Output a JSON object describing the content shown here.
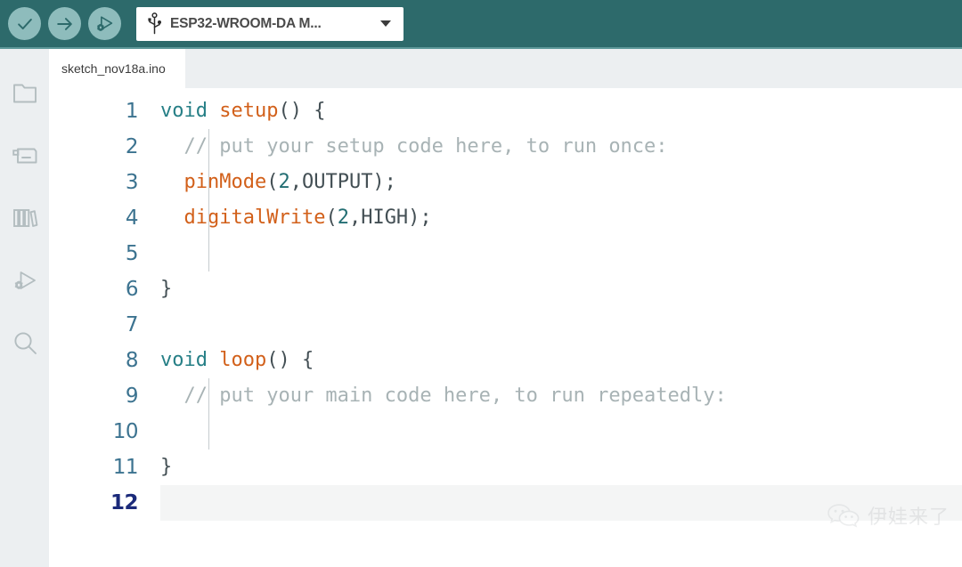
{
  "toolbar": {
    "buttons": [
      {
        "name": "verify-button",
        "icon": "checkmark-icon",
        "tooltip": "Verify"
      },
      {
        "name": "upload-button",
        "icon": "arrow-right-icon",
        "tooltip": "Upload"
      },
      {
        "name": "debug-button",
        "icon": "debug-play-bug-icon",
        "tooltip": "Start Debugging"
      }
    ],
    "board_selector": {
      "icon": "usb-icon",
      "value": "ESP32-WROOM-DA M...",
      "caret_icon": "chevron-down-icon"
    },
    "background_color": "#2d6a6b",
    "button_color": "#8ebcbc"
  },
  "activitybar": {
    "items": [
      {
        "name": "sidebar-item-sketchbook",
        "icon": "folder-icon"
      },
      {
        "name": "sidebar-item-boards-manager",
        "icon": "boards-manager-icon"
      },
      {
        "name": "sidebar-item-library-manager",
        "icon": "library-books-icon"
      },
      {
        "name": "sidebar-item-debug",
        "icon": "debug-play-bug-icon"
      },
      {
        "name": "sidebar-item-search",
        "icon": "search-icon"
      }
    ],
    "background_color": "#eceff1"
  },
  "tabs": [
    {
      "label": "sketch_nov18a.ino",
      "active": true
    }
  ],
  "editor": {
    "active_line": 12,
    "total_lines": 12,
    "colors": {
      "keyword": "#267f86",
      "function": "#d2601a",
      "comment": "#a8b3b5",
      "number": "#236e73",
      "plain": "#434f54",
      "line_number": "#3c7390",
      "active_line_number": "#1b2a7a",
      "active_line_bg": "#f4f5f5"
    },
    "lines": [
      {
        "num": "1",
        "tokens": [
          {
            "t": "void",
            "c": "kw"
          },
          {
            "t": " ",
            "c": "pl"
          },
          {
            "t": "setup",
            "c": "fn"
          },
          {
            "t": "() {",
            "c": "pl"
          }
        ]
      },
      {
        "num": "2",
        "tokens": [
          {
            "t": "  // put your setup code here, to run once:",
            "c": "com"
          }
        ]
      },
      {
        "num": "3",
        "tokens": [
          {
            "t": "  ",
            "c": "pl"
          },
          {
            "t": "pinMode",
            "c": "fn"
          },
          {
            "t": "(",
            "c": "pl"
          },
          {
            "t": "2",
            "c": "num"
          },
          {
            "t": ",OUTPUT);",
            "c": "pl"
          }
        ]
      },
      {
        "num": "4",
        "tokens": [
          {
            "t": "  ",
            "c": "pl"
          },
          {
            "t": "digitalWrite",
            "c": "fn"
          },
          {
            "t": "(",
            "c": "pl"
          },
          {
            "t": "2",
            "c": "num"
          },
          {
            "t": ",HIGH);",
            "c": "pl"
          }
        ]
      },
      {
        "num": "5",
        "tokens": [
          {
            "t": "",
            "c": "pl"
          }
        ]
      },
      {
        "num": "6",
        "tokens": [
          {
            "t": "}",
            "c": "pl"
          }
        ]
      },
      {
        "num": "7",
        "tokens": [
          {
            "t": "",
            "c": "pl"
          }
        ]
      },
      {
        "num": "8",
        "tokens": [
          {
            "t": "void",
            "c": "kw"
          },
          {
            "t": " ",
            "c": "pl"
          },
          {
            "t": "loop",
            "c": "fn"
          },
          {
            "t": "() {",
            "c": "pl"
          }
        ]
      },
      {
        "num": "9",
        "tokens": [
          {
            "t": "  // put your main code here, to run repeatedly:",
            "c": "com"
          }
        ]
      },
      {
        "num": "10",
        "tokens": [
          {
            "t": "",
            "c": "pl"
          }
        ]
      },
      {
        "num": "11",
        "tokens": [
          {
            "t": "}",
            "c": "pl"
          }
        ]
      },
      {
        "num": "12",
        "tokens": [
          {
            "t": "",
            "c": "pl"
          }
        ]
      }
    ],
    "indent_guides": [
      {
        "from_line": 2,
        "to_line": 5
      },
      {
        "from_line": 9,
        "to_line": 10
      }
    ]
  },
  "watermark": {
    "icon": "wechat-icon",
    "text": "伊娃来了"
  }
}
